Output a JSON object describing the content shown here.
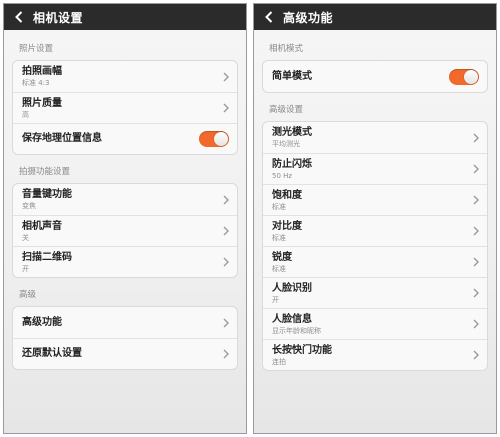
{
  "left": {
    "title": "相机设置",
    "sections": [
      {
        "header": "照片设置",
        "items": [
          {
            "label": "拍照画幅",
            "sub": "标准 4:3"
          },
          {
            "label": "照片质量",
            "sub": "高"
          },
          {
            "label": "保存地理位置信息",
            "toggle": "on"
          }
        ]
      },
      {
        "header": "拍摄功能设置",
        "items": [
          {
            "label": "音量键功能",
            "sub": "变焦"
          },
          {
            "label": "相机声音",
            "sub": "关"
          },
          {
            "label": "扫描二维码",
            "sub": "开"
          }
        ]
      },
      {
        "header": "高级",
        "items": [
          {
            "label": "高级功能"
          },
          {
            "label": "还原默认设置"
          }
        ]
      }
    ]
  },
  "right": {
    "title": "高级功能",
    "sections": [
      {
        "header": "相机模式",
        "items": [
          {
            "label": "简单模式",
            "toggle": "on"
          }
        ]
      },
      {
        "header": "高级设置",
        "items": [
          {
            "label": "测光模式",
            "sub": "平均测光"
          },
          {
            "label": "防止闪烁",
            "sub": "50 Hz"
          },
          {
            "label": "饱和度",
            "sub": "标准"
          },
          {
            "label": "对比度",
            "sub": "标准"
          },
          {
            "label": "锐度",
            "sub": "标准"
          },
          {
            "label": "人脸识别",
            "sub": "开"
          },
          {
            "label": "人脸信息",
            "sub": "显示年龄和昵称"
          },
          {
            "label": "长按快门功能",
            "sub": "连拍"
          }
        ]
      }
    ]
  },
  "colors": {
    "accent": "#f26a2b",
    "titlebar": "#2b2b2b"
  },
  "icons": {
    "back": "chevron-left-icon",
    "row": "chevron-right-icon"
  }
}
